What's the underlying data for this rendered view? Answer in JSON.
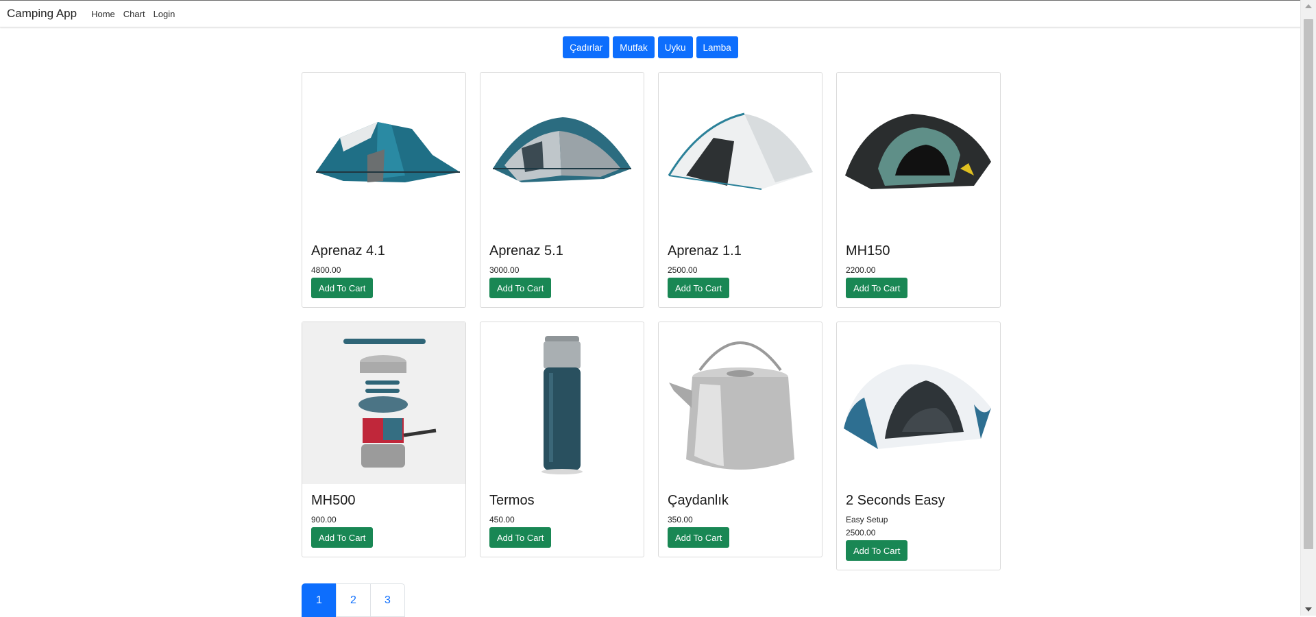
{
  "app": {
    "brand": "Camping App"
  },
  "nav": {
    "links": [
      "Home",
      "Chart",
      "Login"
    ]
  },
  "categories": [
    "Çadırlar",
    "Mutfak",
    "Uyku",
    "Lamba"
  ],
  "colors": {
    "primary": "#0d6efd",
    "success": "#198754"
  },
  "products": [
    {
      "name": "Aprenaz 4.1",
      "description": "",
      "price": "4800.00",
      "button": "Add To Cart",
      "image": "tent-icon"
    },
    {
      "name": "Aprenaz 5.1",
      "description": "",
      "price": "3000.00",
      "button": "Add To Cart",
      "image": "tent-icon"
    },
    {
      "name": "Aprenaz 1.1",
      "description": "",
      "price": "2500.00",
      "button": "Add To Cart",
      "image": "tent-icon"
    },
    {
      "name": "MH150",
      "description": "",
      "price": "2200.00",
      "button": "Add To Cart",
      "image": "tent-icon"
    },
    {
      "name": "MH500",
      "description": "",
      "price": "900.00",
      "button": "Add To Cart",
      "image": "cookware-icon"
    },
    {
      "name": "Termos",
      "description": "",
      "price": "450.00",
      "button": "Add To Cart",
      "image": "thermos-icon"
    },
    {
      "name": "Çaydanlık",
      "description": "",
      "price": "350.00",
      "button": "Add To Cart",
      "image": "kettle-icon"
    },
    {
      "name": "2 Seconds Easy",
      "description": "Easy Setup",
      "price": "2500.00",
      "button": "Add To Cart",
      "image": "tent-icon"
    }
  ],
  "pagination": {
    "pages": [
      "1",
      "2",
      "3"
    ],
    "current": "1"
  }
}
